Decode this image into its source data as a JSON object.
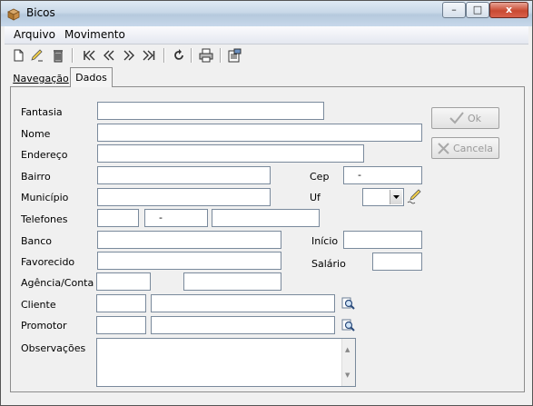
{
  "window": {
    "title": "Bicos",
    "controls": {
      "minimize": "–",
      "maximize": "□",
      "close": "x"
    }
  },
  "menu": [
    "Arquivo",
    "Movimento"
  ],
  "toolbar": [
    "new-icon",
    "edit-icon",
    "delete-icon",
    "first-icon",
    "prev-icon",
    "next-icon",
    "last-icon",
    "refresh-icon",
    "print-icon",
    "report-icon"
  ],
  "tabs": {
    "navegacao": "Navegação",
    "dados": "Dados"
  },
  "form": {
    "fantasia_label": "Fantasia",
    "nome_label": "Nome",
    "endereco_label": "Endereço",
    "bairro_label": "Bairro",
    "cep_label": "Cep",
    "cep_value": "-",
    "municipio_label": "Município",
    "uf_label": "Uf",
    "telefones_label": "Telefones",
    "telefone_mid_value": "-",
    "banco_label": "Banco",
    "inicio_label": "Início",
    "favorecido_label": "Favorecido",
    "salario_label": "Salário",
    "agencia_label": "Agência/Conta",
    "cliente_label": "Cliente",
    "promotor_label": "Promotor",
    "observacoes_label": "Observações"
  },
  "buttons": {
    "ok": "Ok",
    "cancela": "Cancela"
  },
  "colors": {
    "accent_disabled": "#9a9a9a",
    "field_border": "#7a8a9c"
  }
}
